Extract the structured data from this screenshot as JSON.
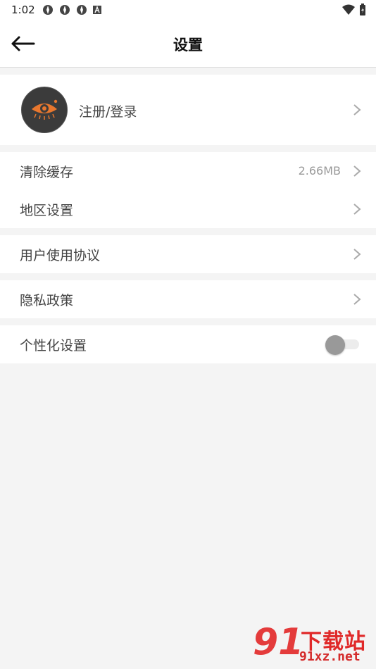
{
  "status_bar": {
    "time": "1:02",
    "left_icons": [
      "notification-icon",
      "notification-icon",
      "notification-icon",
      "a-badge-icon"
    ],
    "right_icons": [
      "wifi-icon",
      "battery-icon"
    ]
  },
  "header": {
    "title": "设置",
    "back_icon": "arrow-left-icon"
  },
  "profile": {
    "label": "注册/登录"
  },
  "settings": {
    "clear_cache": {
      "label": "清除缓存",
      "value": "2.66MB"
    },
    "region": {
      "label": "地区设置"
    },
    "user_agreement": {
      "label": "用户使用协议"
    },
    "privacy": {
      "label": "隐私政策"
    },
    "personalization": {
      "label": "个性化设置",
      "enabled": false
    }
  },
  "watermark": {
    "number": "91",
    "text": "下载站",
    "url": "91xz.net"
  },
  "colors": {
    "accent": "#e8772e",
    "background": "#f4f4f4",
    "watermark": "#e02929"
  }
}
